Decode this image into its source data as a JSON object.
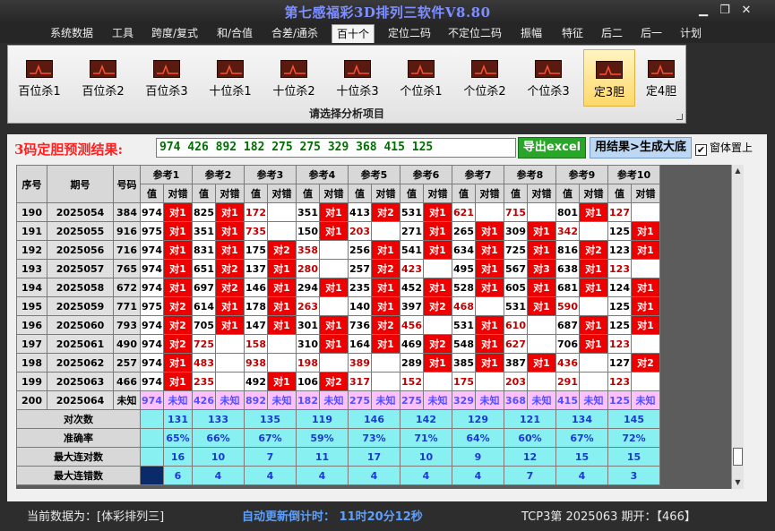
{
  "window": {
    "title": "第七感福彩3D排列三软件V8.80"
  },
  "menu": [
    "系统数据",
    "工具",
    "跨度/复式",
    "和/合值",
    "合差/通杀",
    "百十个",
    "定位二码",
    "不定位二码",
    "振幅",
    "特征",
    "后二",
    "后一",
    "计划"
  ],
  "menu_active": 5,
  "ribbon": {
    "buttons": [
      "百位杀1",
      "百位杀2",
      "百位杀3",
      "十位杀1",
      "十位杀2",
      "十位杀3",
      "个位杀1",
      "个位杀2",
      "个位杀3",
      "定3胆",
      "定4胆"
    ],
    "selected": 9,
    "caption": "请选择分析项目"
  },
  "result": {
    "label": "3码定胆预测结果:",
    "value": "974 426 892 182 275 275 329 368 415 125",
    "excel_button": "导出excel",
    "generate_button": "用结果>生成大底",
    "checkbox_label": "窗体置上",
    "checkbox_checked": true
  },
  "grid": {
    "head": {
      "idx": "序号",
      "period": "期号",
      "number": "号码",
      "value": "值",
      "check": "对错"
    },
    "groups": [
      "参考1",
      "参考2",
      "参考3",
      "参考4",
      "参考5",
      "参考6",
      "参考7",
      "参考8",
      "参考9",
      "参考10"
    ],
    "rows": [
      {
        "idx": "190",
        "period": "2025054",
        "num": "384",
        "cells": [
          [
            "974",
            "对1"
          ],
          [
            "825",
            "对1"
          ],
          [
            "172",
            ""
          ],
          [
            "351",
            "对1"
          ],
          [
            "413",
            "对2"
          ],
          [
            "531",
            "对1"
          ],
          [
            "621",
            ""
          ],
          [
            "715",
            ""
          ],
          [
            "801",
            "对1"
          ],
          [
            "127",
            ""
          ]
        ]
      },
      {
        "idx": "191",
        "period": "2025055",
        "num": "916",
        "cells": [
          [
            "975",
            "对1"
          ],
          [
            "351",
            "对1"
          ],
          [
            "735",
            ""
          ],
          [
            "150",
            "对1"
          ],
          [
            "203",
            ""
          ],
          [
            "271",
            "对1"
          ],
          [
            "265",
            "对1"
          ],
          [
            "309",
            "对1"
          ],
          [
            "342",
            ""
          ],
          [
            "125",
            "对1"
          ]
        ]
      },
      {
        "idx": "192",
        "period": "2025056",
        "num": "716",
        "cells": [
          [
            "974",
            "对1"
          ],
          [
            "831",
            "对1"
          ],
          [
            "175",
            "对2"
          ],
          [
            "358",
            ""
          ],
          [
            "256",
            "对1"
          ],
          [
            "541",
            "对1"
          ],
          [
            "634",
            "对1"
          ],
          [
            "725",
            "对1"
          ],
          [
            "816",
            "对2"
          ],
          [
            "123",
            "对1"
          ]
        ]
      },
      {
        "idx": "193",
        "period": "2025057",
        "num": "765",
        "cells": [
          [
            "974",
            "对1"
          ],
          [
            "651",
            "对2"
          ],
          [
            "137",
            "对1"
          ],
          [
            "280",
            ""
          ],
          [
            "257",
            "对2"
          ],
          [
            "423",
            ""
          ],
          [
            "495",
            "对1"
          ],
          [
            "567",
            "对3"
          ],
          [
            "638",
            "对1"
          ],
          [
            "123",
            ""
          ]
        ]
      },
      {
        "idx": "194",
        "period": "2025058",
        "num": "672",
        "cells": [
          [
            "974",
            "对1"
          ],
          [
            "697",
            "对2"
          ],
          [
            "146",
            "对1"
          ],
          [
            "294",
            "对1"
          ],
          [
            "235",
            "对1"
          ],
          [
            "452",
            "对1"
          ],
          [
            "528",
            "对1"
          ],
          [
            "605",
            "对1"
          ],
          [
            "681",
            "对1"
          ],
          [
            "124",
            "对1"
          ]
        ]
      },
      {
        "idx": "195",
        "period": "2025059",
        "num": "771",
        "cells": [
          [
            "975",
            "对2"
          ],
          [
            "614",
            "对1"
          ],
          [
            "178",
            "对1"
          ],
          [
            "263",
            ""
          ],
          [
            "140",
            "对1"
          ],
          [
            "397",
            "对2"
          ],
          [
            "468",
            ""
          ],
          [
            "531",
            "对1"
          ],
          [
            "590",
            ""
          ],
          [
            "125",
            "对1"
          ]
        ]
      },
      {
        "idx": "196",
        "period": "2025060",
        "num": "793",
        "cells": [
          [
            "974",
            "对2"
          ],
          [
            "705",
            "对1"
          ],
          [
            "147",
            "对1"
          ],
          [
            "301",
            "对1"
          ],
          [
            "736",
            "对2"
          ],
          [
            "456",
            ""
          ],
          [
            "531",
            "对1"
          ],
          [
            "610",
            ""
          ],
          [
            "687",
            "对1"
          ],
          [
            "125",
            "对1"
          ]
        ]
      },
      {
        "idx": "197",
        "period": "2025061",
        "num": "490",
        "cells": [
          [
            "974",
            "对2"
          ],
          [
            "725",
            ""
          ],
          [
            "158",
            ""
          ],
          [
            "310",
            "对1"
          ],
          [
            "164",
            "对1"
          ],
          [
            "469",
            "对2"
          ],
          [
            "548",
            "对1"
          ],
          [
            "627",
            ""
          ],
          [
            "706",
            "对1"
          ],
          [
            "123",
            ""
          ]
        ]
      },
      {
        "idx": "198",
        "period": "2025062",
        "num": "257",
        "cells": [
          [
            "974",
            "对1"
          ],
          [
            "483",
            ""
          ],
          [
            "938",
            ""
          ],
          [
            "198",
            ""
          ],
          [
            "389",
            ""
          ],
          [
            "289",
            "对1"
          ],
          [
            "385",
            "对1"
          ],
          [
            "387",
            "对1"
          ],
          [
            "436",
            ""
          ],
          [
            "127",
            "对2"
          ]
        ]
      },
      {
        "idx": "199",
        "period": "2025063",
        "num": "466",
        "cells": [
          [
            "974",
            "对1"
          ],
          [
            "235",
            ""
          ],
          [
            "492",
            "对1"
          ],
          [
            "106",
            "对2"
          ],
          [
            "317",
            ""
          ],
          [
            "152",
            ""
          ],
          [
            "175",
            ""
          ],
          [
            "203",
            ""
          ],
          [
            "291",
            ""
          ],
          [
            "123",
            ""
          ]
        ]
      }
    ],
    "red_values": [
      [
        false,
        false,
        true,
        false,
        false,
        false,
        true,
        true,
        false,
        true
      ],
      [
        false,
        false,
        true,
        false,
        true,
        false,
        false,
        false,
        true,
        false
      ],
      [
        false,
        false,
        false,
        true,
        false,
        false,
        false,
        false,
        false,
        false
      ],
      [
        false,
        false,
        false,
        true,
        false,
        true,
        false,
        false,
        false,
        true
      ],
      [
        false,
        false,
        false,
        false,
        false,
        false,
        false,
        false,
        false,
        false
      ],
      [
        false,
        false,
        false,
        true,
        false,
        false,
        true,
        false,
        true,
        false
      ],
      [
        false,
        false,
        false,
        false,
        false,
        true,
        false,
        true,
        false,
        false
      ],
      [
        false,
        true,
        true,
        false,
        false,
        false,
        false,
        true,
        false,
        true
      ],
      [
        false,
        true,
        true,
        true,
        true,
        false,
        false,
        false,
        true,
        false
      ],
      [
        false,
        true,
        false,
        false,
        true,
        true,
        true,
        true,
        true,
        true
      ]
    ],
    "last_row": {
      "idx": "200",
      "period": "2025064",
      "num": "未知",
      "cells": [
        [
          "974",
          "未知"
        ],
        [
          "426",
          "未知"
        ],
        [
          "892",
          "未知"
        ],
        [
          "182",
          "未知"
        ],
        [
          "275",
          "未知"
        ],
        [
          "275",
          "未知"
        ],
        [
          "329",
          "未知"
        ],
        [
          "368",
          "未知"
        ],
        [
          "415",
          "未知"
        ],
        [
          "125",
          "未知"
        ]
      ]
    },
    "stats": [
      {
        "label": "对次数",
        "values": [
          "131",
          "133",
          "135",
          "119",
          "146",
          "142",
          "129",
          "121",
          "134",
          "145"
        ]
      },
      {
        "label": "准确率",
        "values": [
          "65%",
          "66%",
          "67%",
          "59%",
          "73%",
          "71%",
          "64%",
          "60%",
          "67%",
          "72%"
        ]
      },
      {
        "label": "最大连对数",
        "values": [
          "16",
          "10",
          "7",
          "11",
          "17",
          "10",
          "9",
          "12",
          "15",
          "15"
        ]
      },
      {
        "label": "最大连错数",
        "values": [
          "6",
          "4",
          "4",
          "4",
          "4",
          "4",
          "4",
          "7",
          "4",
          "3"
        ]
      }
    ]
  },
  "status": {
    "current": "当前数据为：[体彩排列三]",
    "countdown": "自动更新倒计时：  11时20分12秒",
    "draw": "TCP3第 2025063 期开：【466】"
  },
  "colors": {
    "hit_red": "#ee0000",
    "red_text": "#c00000",
    "stat_cyan": "#88f0f0",
    "predict_pink": "#ffc0ff"
  }
}
